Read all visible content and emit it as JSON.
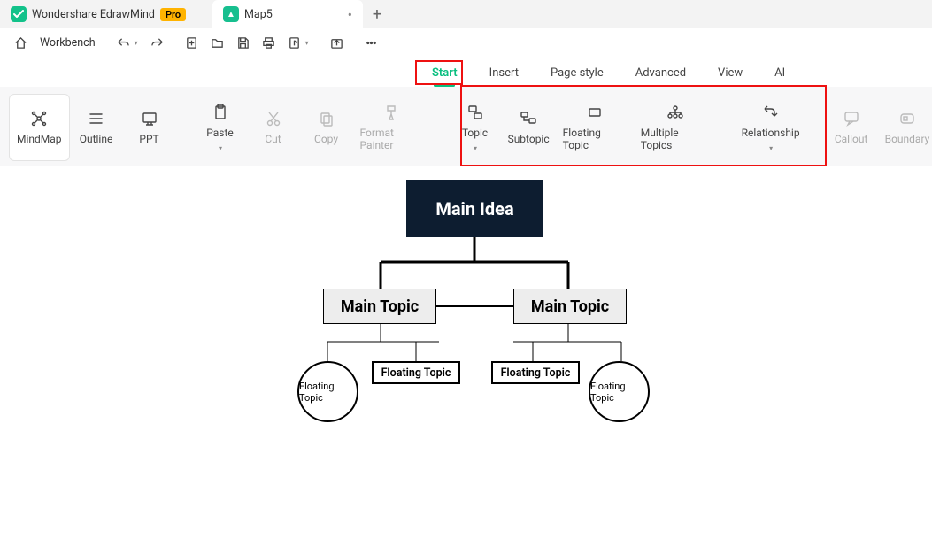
{
  "title": {
    "app": "Wondershare EdrawMind",
    "pro": "Pro",
    "doc": "Map5"
  },
  "tb1": {
    "workbench": "Workbench"
  },
  "menu": {
    "start": "Start",
    "insert": "Insert",
    "page_style": "Page style",
    "advanced": "Advanced",
    "view": "View",
    "ai": "AI"
  },
  "ribbon": {
    "mindmap": "MindMap",
    "outline": "Outline",
    "ppt": "PPT",
    "paste": "Paste",
    "cut": "Cut",
    "copy": "Copy",
    "format_painter": "Format Painter",
    "topic": "Topic",
    "subtopic": "Subtopic",
    "floating_topic": "Floating Topic",
    "multiple_topics": "Multiple Topics",
    "relationship": "Relationship",
    "callout": "Callout",
    "boundary": "Boundary"
  },
  "nodes": {
    "root": "Main Idea",
    "main1": "Main Topic",
    "main2": "Main Topic",
    "ft1": "Floating Topic",
    "ft2": "Floating Topic",
    "c1": "Floating Topic",
    "c2": "Floating Topic"
  }
}
